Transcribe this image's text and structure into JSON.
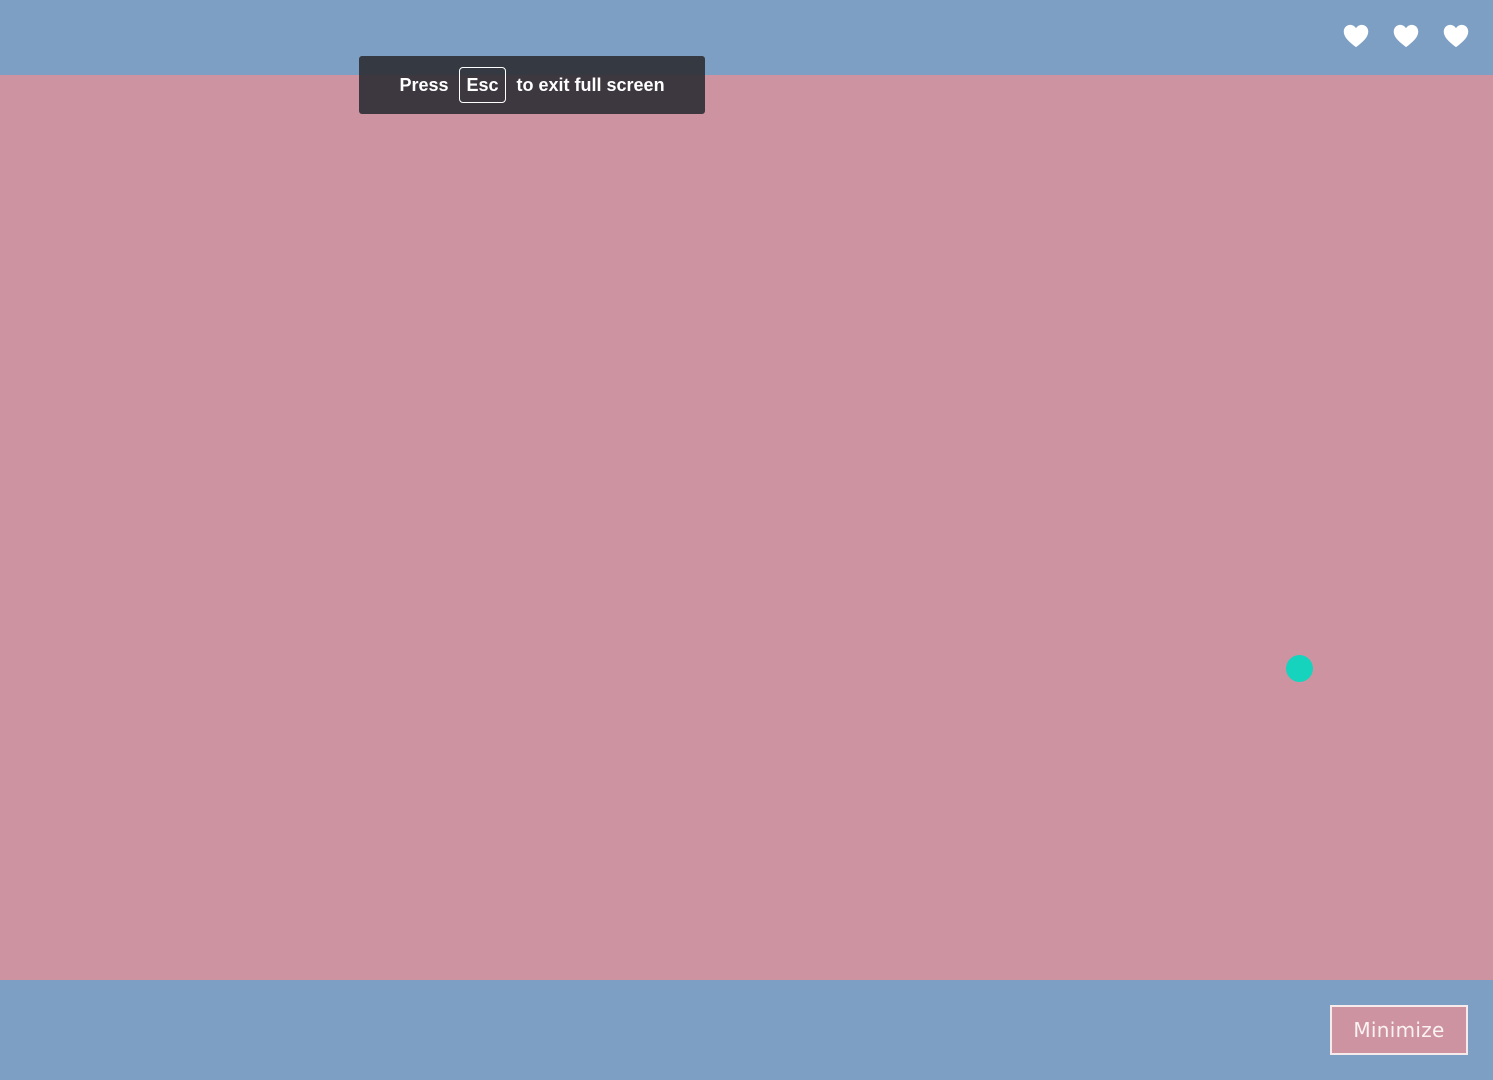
{
  "lives": {
    "count": 3,
    "icon": "heart-icon",
    "color": "#ffffff"
  },
  "fullscreen_toast": {
    "prefix": "Press",
    "key": "Esc",
    "suffix": "to exit full screen"
  },
  "controls": {
    "minimize_label": "Minimize"
  },
  "colors": {
    "frame": "#7e9fc4",
    "play_area": "#ce93a1",
    "ball": "#15d3bd",
    "toast_bg": "#2d2d34"
  }
}
